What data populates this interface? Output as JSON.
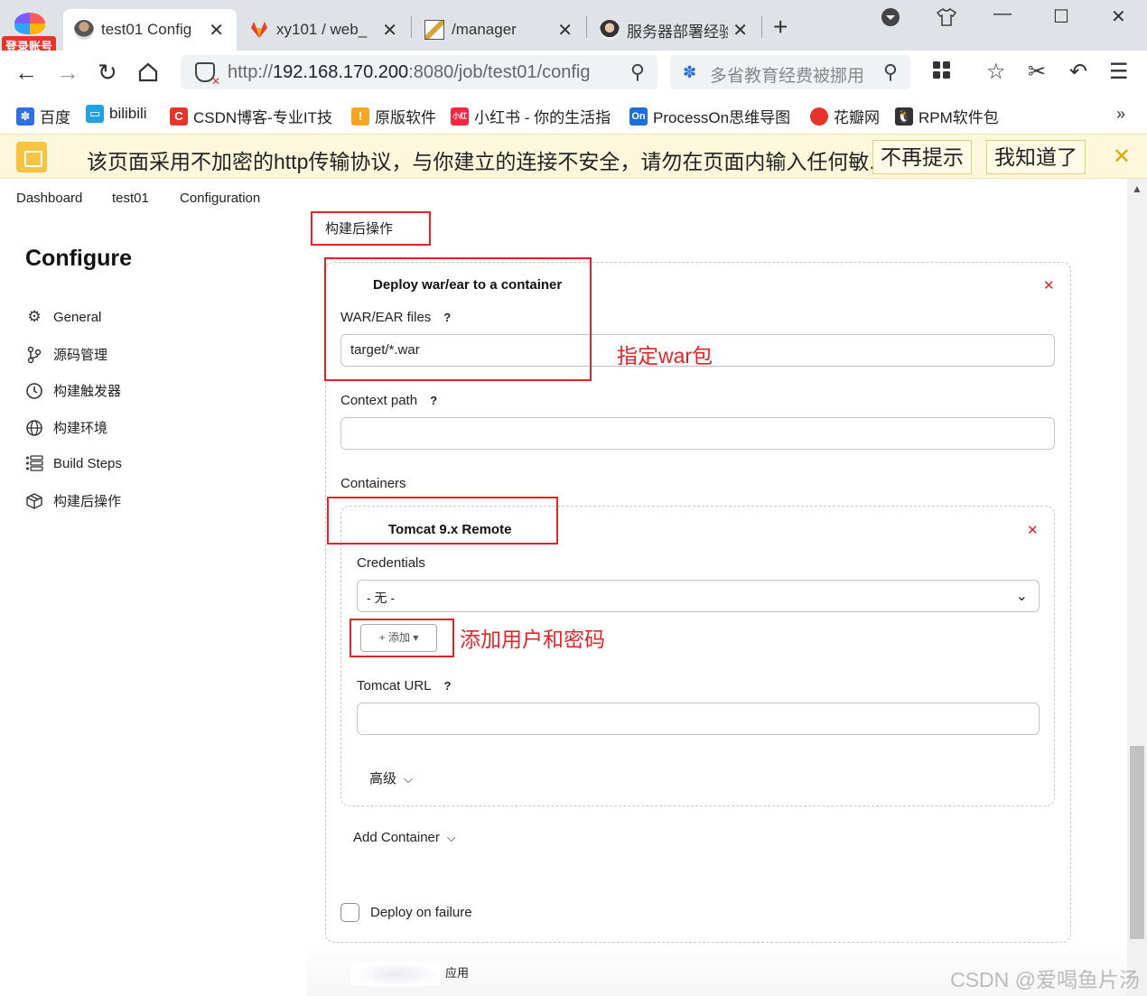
{
  "browser": {
    "login_badge": "登录账号",
    "tabs": [
      {
        "label": "test01 Config",
        "active": true,
        "icon": "avatar-icon"
      },
      {
        "label": "xy101 / web_",
        "active": false,
        "icon": "gitlab-icon"
      },
      {
        "label": "/manager",
        "active": false,
        "icon": "tomcat-icon"
      },
      {
        "label": "服务器部署经验",
        "active": false,
        "icon": "avatar-icon"
      }
    ],
    "url": {
      "prefix": "http://",
      "host": "192.168.170.200",
      "rest": ":8080/job/test01/config"
    },
    "search_placeholder": "多省教育经费被挪用",
    "bookmarks": [
      {
        "label": "百度",
        "icon_color": "#2f6fe0",
        "icon": "baidu-icon"
      },
      {
        "label": "bilibili",
        "icon_color": "#1fa3e0",
        "icon": "bilibili-icon"
      },
      {
        "label": "CSDN博客-专业IT技",
        "icon_color": "#e5352b",
        "icon": "csdn-icon"
      },
      {
        "label": "原版软件",
        "icon_color": "#f6a623",
        "icon": "software-icon"
      },
      {
        "label": "小红书 - 你的生活指",
        "icon_color": "#ff2442",
        "icon": "xiaohongshu-icon"
      },
      {
        "label": "ProcessOn思维导图",
        "icon_color": "#1e6fd9",
        "icon": "processon-icon"
      },
      {
        "label": "花瓣网",
        "icon_color": "#e5352b",
        "icon": "huaban-icon"
      },
      {
        "label": "RPM软件包",
        "icon_color": "#333333",
        "icon": "linux-icon"
      }
    ],
    "more": "»"
  },
  "warning": {
    "text": "该页面采用不加密的http传输协议，与你建立的连接不安全，请勿在页面内输入任何敏...",
    "dismiss_forever": "不再提示",
    "acknowledge": "我知道了"
  },
  "breadcrumb": [
    "Dashboard",
    "test01",
    "Configuration"
  ],
  "sidebar": {
    "title": "Configure",
    "items": [
      {
        "label": "General",
        "icon": "gear-icon"
      },
      {
        "label": "源码管理",
        "icon": "branch-icon"
      },
      {
        "label": "构建触发器",
        "icon": "clock-icon"
      },
      {
        "label": "构建环境",
        "icon": "globe-icon"
      },
      {
        "label": "Build Steps",
        "icon": "list-icon"
      },
      {
        "label": "构建后操作",
        "icon": "package-icon"
      }
    ]
  },
  "main": {
    "section_title": "构建后操作",
    "deploy": {
      "title": "Deploy war/ear to a container",
      "war_label": "WAR/EAR files",
      "war_value": "target/*.war",
      "context_label": "Context path",
      "context_value": "",
      "containers_label": "Containers",
      "help": "?"
    },
    "container": {
      "title": "Tomcat 9.x Remote",
      "credentials_label": "Credentials",
      "credentials_value": "- 无 -",
      "add_button": "+ 添加 ▾",
      "url_label": "Tomcat URL",
      "url_value": "",
      "advanced": "高级"
    },
    "add_container": "Add Container",
    "deploy_on_failure": "Deploy on failure",
    "deploy_on_failure_checked": false,
    "save": "保存",
    "apply": "应用"
  },
  "annotations": {
    "war_note": "指定war包",
    "cred_note": "添加用户和密码"
  },
  "watermark": "CSDN @爱喝鱼片汤",
  "colors": {
    "annotation": "#e0242a",
    "delete": "#e0242a",
    "warning_bg": "#fdf8dc"
  }
}
